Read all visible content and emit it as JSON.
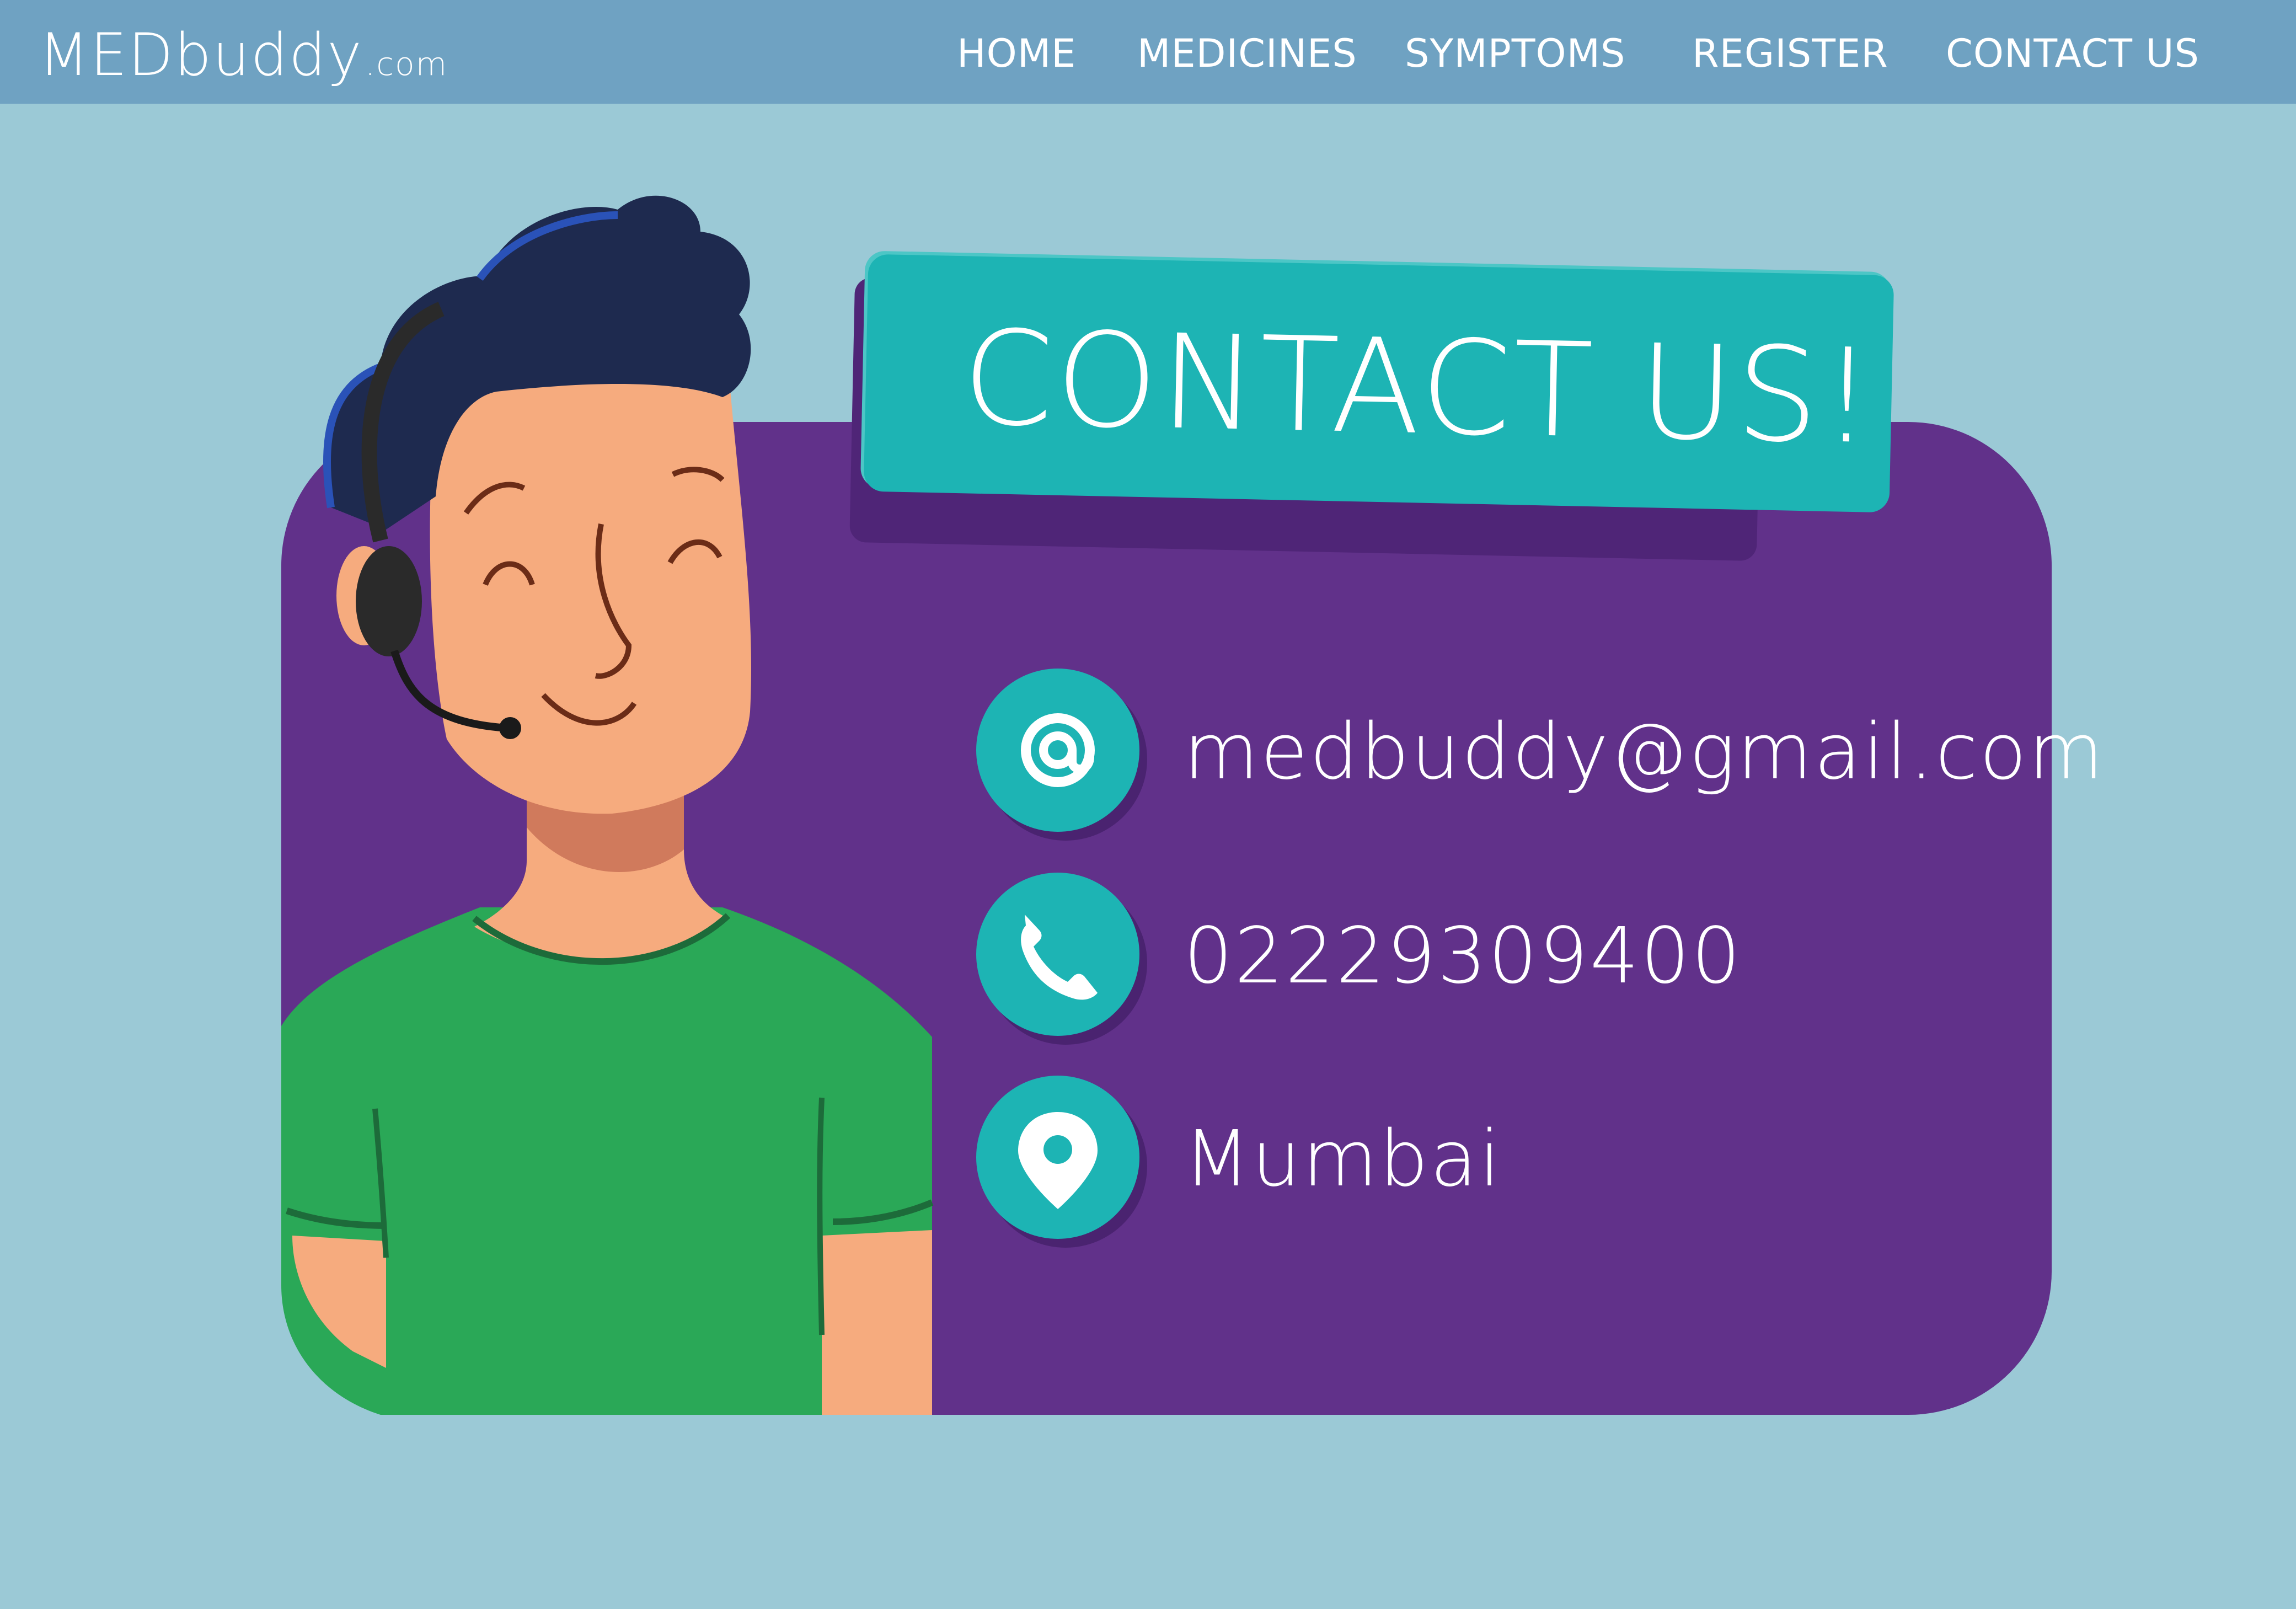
{
  "header": {
    "logo_main": "MEDbuddy",
    "logo_suffix": ".com",
    "nav": {
      "home": "HOME",
      "medicines": "MEDICINES",
      "symptoms": "SYMPTOMS",
      "register": "REGISTER",
      "contact": "CONTACT US"
    }
  },
  "main": {
    "banner_title": "CONTACT US!",
    "email": {
      "icon": "at-icon",
      "text": "medbuddy@gmail.com"
    },
    "phone": {
      "icon": "phone-icon",
      "text": "02229309400"
    },
    "location": {
      "icon": "location-pin-icon",
      "text": "Mumbai"
    }
  },
  "colors": {
    "page_background": "#9bc9d6",
    "navbar": "#6fa2c2",
    "card": "#61318a",
    "accent_teal": "#1db4b4",
    "shirt_green": "#2aa857"
  }
}
